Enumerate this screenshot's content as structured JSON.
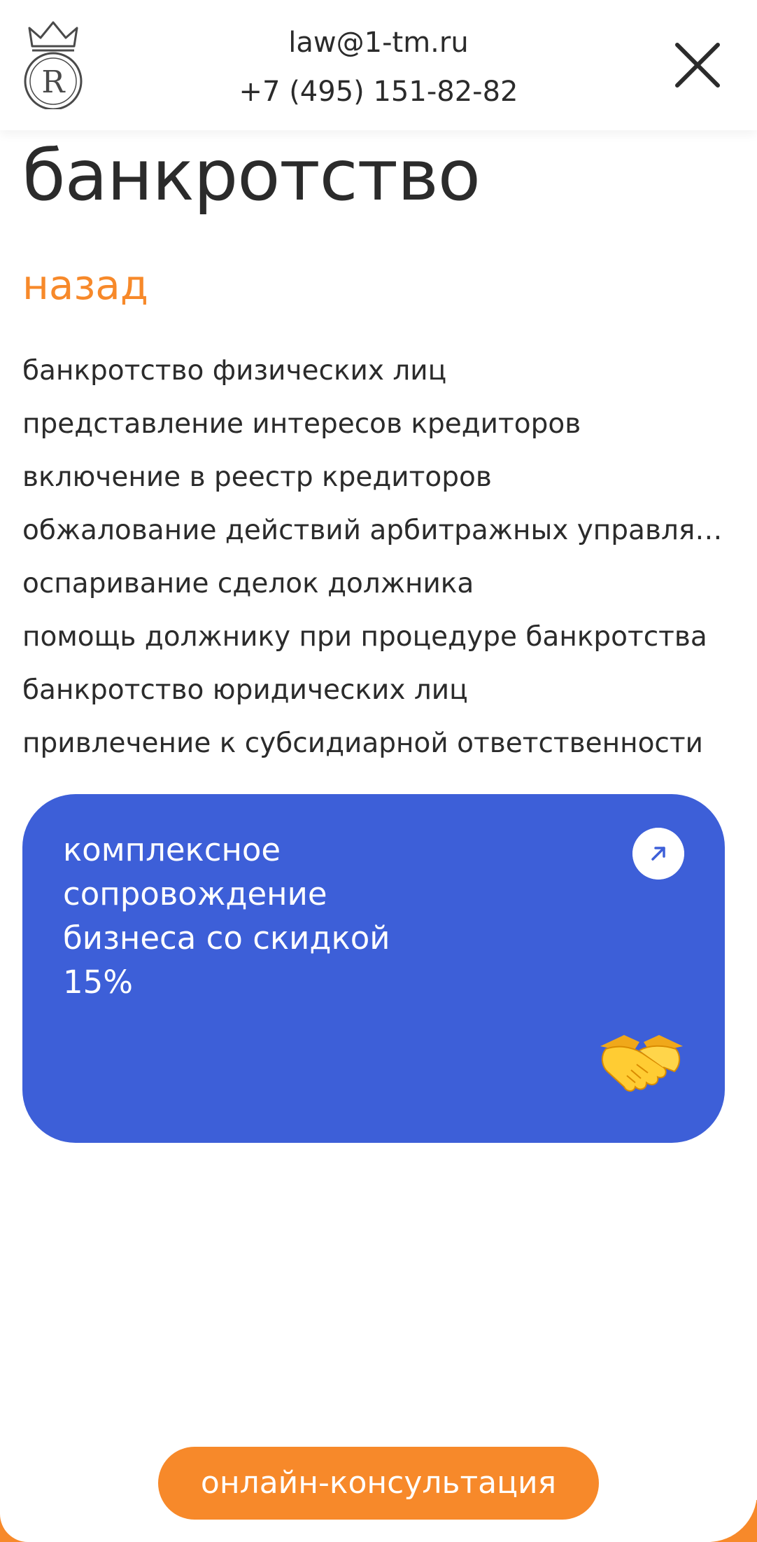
{
  "header": {
    "email": "law@1-tm.ru",
    "phone": "+7 (495) 151-82-82",
    "logo_icon": "crown-r-logo-icon",
    "close_icon": "close-icon"
  },
  "page": {
    "title": "банкротство",
    "back_label": "назад"
  },
  "menu": {
    "items": [
      "банкротство физических лиц",
      "представление интересов кредиторов",
      "включение в реестр кредиторов",
      "обжалование действий арбитражных управляющих",
      "оспаривание сделок должника",
      "помощь должнику при процедуре банкротства",
      "банкротство юридических лиц",
      "привлечение к субсидиарной ответственности"
    ]
  },
  "promo": {
    "lines": [
      "комплексное",
      "сопровождение",
      "бизнеса со скидкой",
      "15%"
    ],
    "arrow_icon": "arrow-up-right-icon",
    "image_icon": "handshake-icon"
  },
  "cta": {
    "label": "онлайн-консультация"
  },
  "colors": {
    "accent": "#f7892a",
    "promo_bg": "#3d5fd8",
    "text": "#2b2b2b"
  }
}
